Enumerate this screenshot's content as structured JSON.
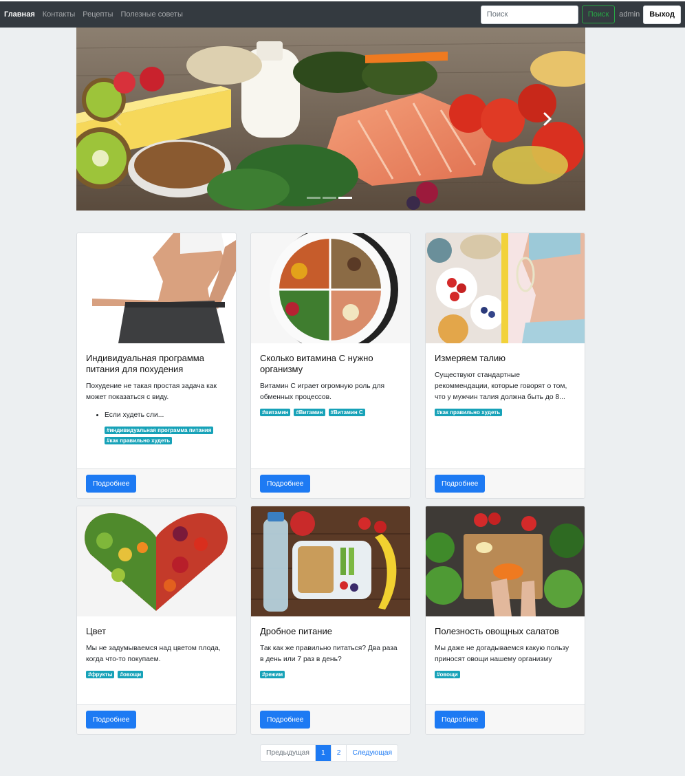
{
  "nav": {
    "links": [
      {
        "label": "Главная",
        "active": true
      },
      {
        "label": "Контакты",
        "active": false
      },
      {
        "label": "Рецепты",
        "active": false
      },
      {
        "label": "Полезные советы",
        "active": false
      }
    ],
    "search_placeholder": "Поиск",
    "search_button": "Поиск",
    "user": "admin",
    "logout": "Выход"
  },
  "carousel": {
    "slide_count": 3,
    "active_slide": 3,
    "prev_icon": "chevron-left-icon",
    "next_icon": "chevron-right-icon"
  },
  "cards": [
    {
      "title": "Индивидуальная программа питания для похудения",
      "text": "Похудение не такая простая задача как может показаться с виду.",
      "list_item": "Если худеть сли...",
      "tags": [
        "#индивидуальная программа питания",
        "#как правильно худеть"
      ],
      "button": "Подробнее"
    },
    {
      "title": "Сколько витамина C нужно организму",
      "text": "Витамин C играет огромную роль для обменных процессов.",
      "tags": [
        "#витамин",
        "#Витамин",
        "#Витамин C"
      ],
      "button": "Подробнее"
    },
    {
      "title": "Измеряем талию",
      "text": "Существуют стандартные рекоммендации, которые говорят о том, что у мужчин талия должна быть до 8...",
      "tags": [
        "#как правильно худеть"
      ],
      "button": "Подробнее"
    },
    {
      "title": "Цвет",
      "text": "Мы не задумываемся над цветом плода, когда что-то покупаем.",
      "tags": [
        "#фрукты",
        "#овощи"
      ],
      "button": "Подробнее"
    },
    {
      "title": "Дробное питание",
      "text": "Так как же правильно питаться? Два раза в день или 7 раз в день?",
      "tags": [
        "#режим"
      ],
      "button": "Подробнее"
    },
    {
      "title": "Полезность овощных салатов",
      "text": "Мы даже не догадываемся какую пользу приносят овощи нашему организму",
      "tags": [
        "#овощи"
      ],
      "button": "Подробнее"
    }
  ],
  "pagination": {
    "prev": "Предыдущая",
    "pages": [
      "1",
      "2"
    ],
    "current": "1",
    "next": "Следующая"
  },
  "colors": {
    "navbar": "#343a40",
    "primary": "#1d7af3",
    "success": "#28a745",
    "tag": "#17a2b8",
    "background": "#eceff1"
  }
}
